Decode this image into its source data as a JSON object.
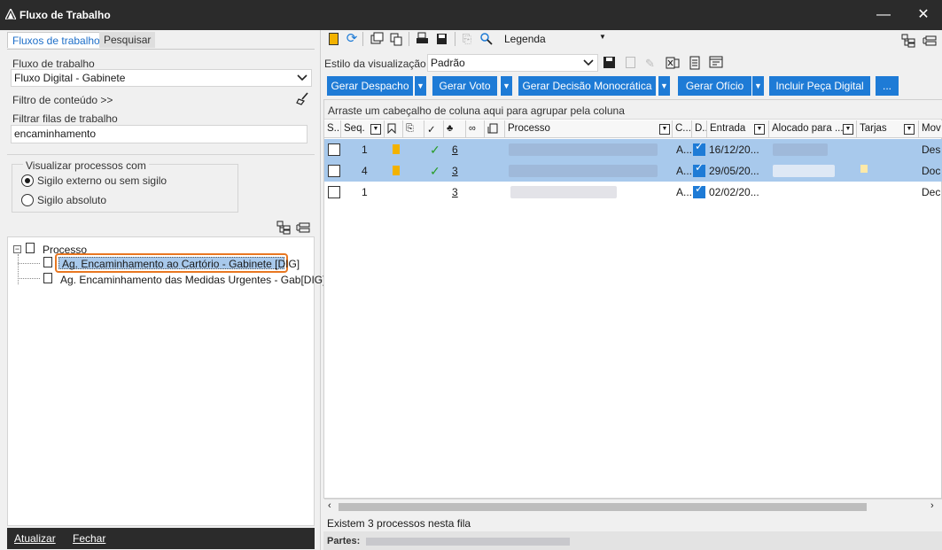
{
  "window": {
    "title": "Fluxo de Trabalho",
    "minimize": "—",
    "close": "✕"
  },
  "left": {
    "tabs": [
      {
        "label": "Fluxos de trabalho"
      },
      {
        "label": "Pesquisar"
      }
    ],
    "workflow_label": "Fluxo de trabalho",
    "workflow_value": "Fluxo Digital - Gabinete",
    "content_filter": "Filtro de conteúdo >>",
    "queue_filter_label": "Filtrar filas de trabalho",
    "queue_filter_value": "encaminhamento",
    "view_group_label": "Visualizar processos com",
    "radio_external": "Sigilo externo ou sem sigilo",
    "radio_absolute": "Sigilo absoluto",
    "tree": {
      "root": "Processo",
      "items": [
        {
          "label": "Ag. Encaminhamento ao Cartório - Gabinete [DIG]"
        },
        {
          "label": "Ag. Encaminhamento das Medidas Urgentes - Gab[DIG]"
        }
      ]
    },
    "footer": {
      "refresh": "Atualizar",
      "close": "Fechar"
    }
  },
  "right": {
    "toolbar": {
      "legend": "Legenda"
    },
    "view_style_label": "Estilo da visualização",
    "view_style_value": "Padrão",
    "buttons": {
      "despacho": "Gerar Despacho",
      "voto": "Gerar Voto",
      "decisao": "Gerar Decisão Monocrática",
      "oficio": "Gerar Ofício",
      "peca": "Incluir Peça Digital",
      "more": "..."
    },
    "group_hint": "Arraste um cabeçalho de coluna aqui para agrupar pela coluna",
    "columns": {
      "s": "S...",
      "seq": "Seq.",
      "processo": "Processo",
      "c": "C...",
      "d": "D...",
      "entrada": "Entrada",
      "alocado": "Alocado para ...",
      "tarjas": "Tarjas",
      "mov": "Mov"
    },
    "rows": [
      {
        "seq": "1",
        "num": "6",
        "c": "A...",
        "entrada": "16/12/20...",
        "mov": "Des"
      },
      {
        "seq": "4",
        "num": "3",
        "c": "A...",
        "entrada": "29/05/20...",
        "mov": "Doc"
      },
      {
        "seq": "1",
        "num": "3",
        "c": "A...",
        "entrada": "02/02/20...",
        "mov": "Dec"
      }
    ],
    "status": "Existem 3 processos nesta fila",
    "partes_label": "Partes:"
  },
  "colors": {
    "accent": "#1e7bd6",
    "highlight_outline": "#e87722",
    "selected_row": "#a8c9ec",
    "flag": "#f2b200",
    "check_green": "#2a9d2a"
  }
}
